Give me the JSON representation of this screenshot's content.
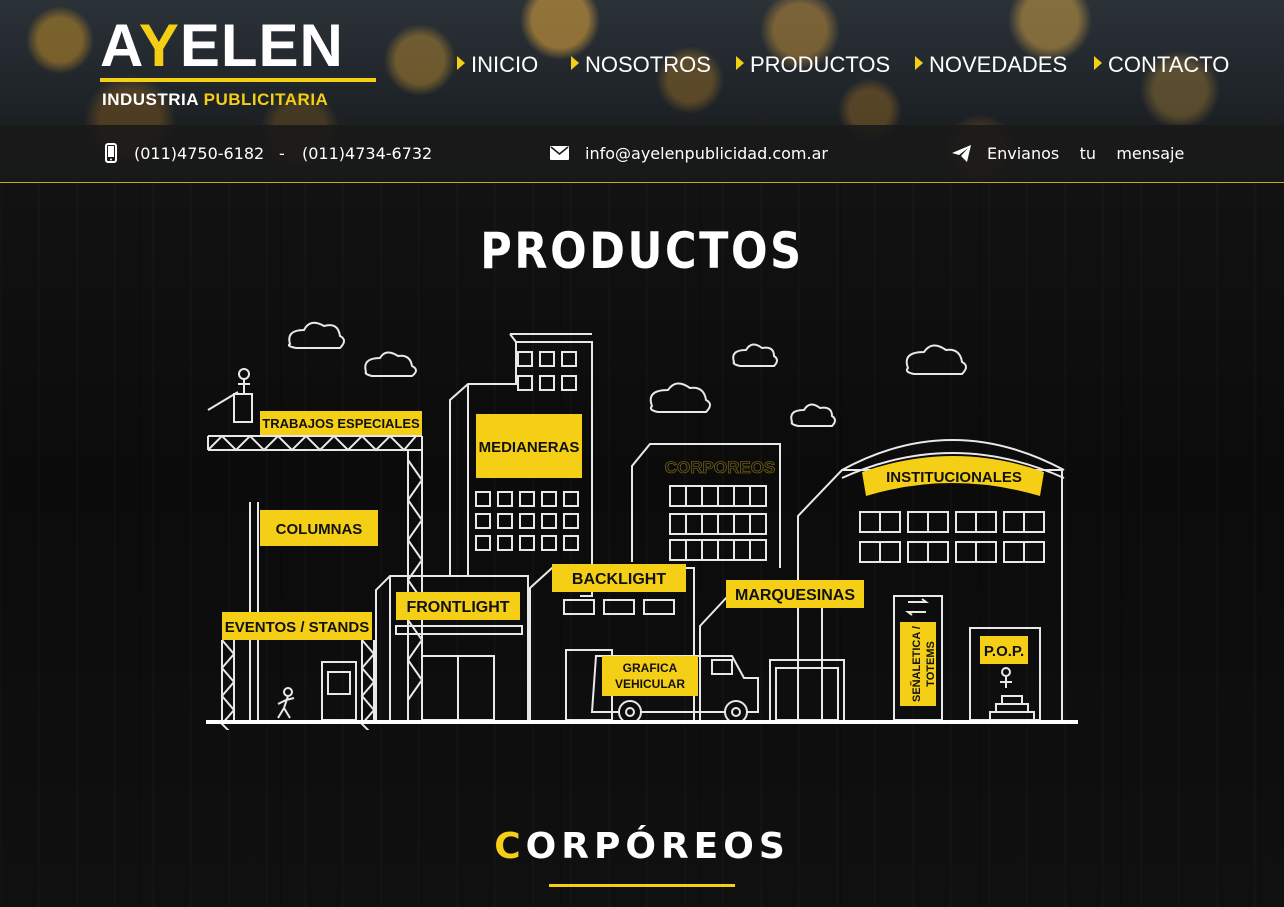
{
  "brand": {
    "name_pre": "A",
    "name_y": "Y",
    "name_post": "ELEN",
    "subtitle_a": "INDUSTRIA ",
    "subtitle_b": "PUBLICITARIA"
  },
  "nav": {
    "items": [
      {
        "label": "INICIO"
      },
      {
        "label": "NOSOTROS"
      },
      {
        "label": "PRODUCTOS"
      },
      {
        "label": "NOVEDADES"
      },
      {
        "label": "CONTACTO"
      }
    ]
  },
  "contact": {
    "phone1": "(011)4750-6182",
    "separator": "-",
    "phone2": "(011)4734-6732",
    "email": "info@ayelenpublicidad.com.ar",
    "message": "Envianos    tu    mensaje"
  },
  "page": {
    "title": "PRODUCTOS"
  },
  "illustration": {
    "labels": {
      "trabajos": "TRABAJOS ESPECIALES",
      "medianeras": "MEDIANERAS",
      "corporeos": "CORPOREOS",
      "institucionales": "INSTITUCIONALES",
      "columnas": "COLUMNAS",
      "backlight": "BACKLIGHT",
      "frontlight": "FRONTLIGHT",
      "marquesinas": "MARQUESINAS",
      "eventos": "EVENTOS / STANDS",
      "grafica1": "GRAFICA",
      "grafica2": "VEHICULAR",
      "senaletica1": "SEÑALETICA /",
      "senaletica2": "TOTEMS",
      "pop": "P.O.P."
    }
  },
  "section": {
    "first_letter": "C",
    "rest": "ORPÓREOS"
  },
  "colors": {
    "accent": "#f4cf16",
    "background": "#0a0a0a",
    "text": "#ffffff"
  }
}
